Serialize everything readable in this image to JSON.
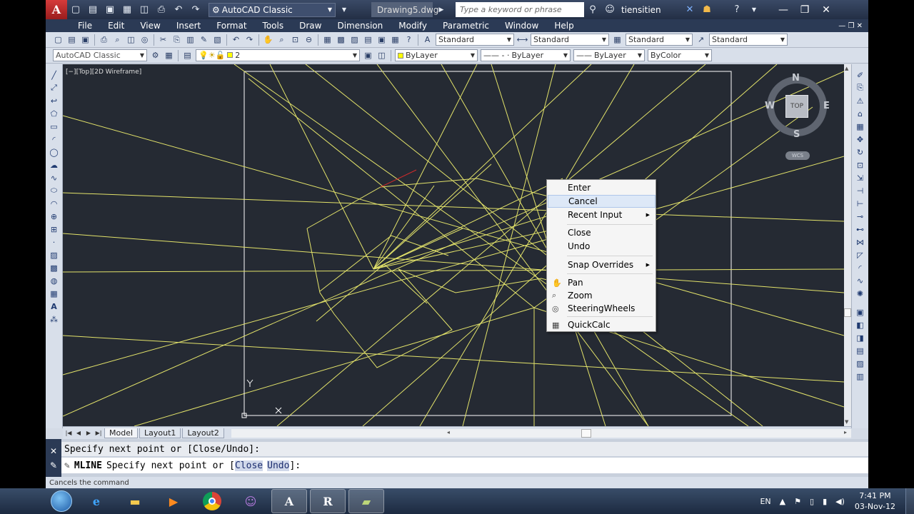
{
  "titlebar": {
    "logo_letter": "A",
    "workspace": "AutoCAD Classic",
    "file_name": "Drawing5.dwg",
    "search_placeholder": "Type a keyword or phrase",
    "user": "tiensitien"
  },
  "menu": [
    "File",
    "Edit",
    "View",
    "Insert",
    "Format",
    "Tools",
    "Draw",
    "Dimension",
    "Modify",
    "Parametric",
    "Window",
    "Help"
  ],
  "toolbar1": {
    "text_style": "Standard",
    "dim_style": "Standard",
    "table_style": "Standard",
    "mleader_style": "Standard"
  },
  "toolbar2": {
    "workspace": "AutoCAD Classic",
    "layer": "2",
    "color": "ByLayer",
    "linetype": "ByLayer",
    "lineweight": "ByLayer",
    "plotstyle": "ByColor"
  },
  "viewport": {
    "label": "[−][Top][2D Wireframe]"
  },
  "viewcube": {
    "north": "N",
    "south": "S",
    "east": "E",
    "west": "W",
    "face": "TOP",
    "ucs": "WCS"
  },
  "tabs": [
    "Model",
    "Layout1",
    "Layout2"
  ],
  "context_menu": {
    "items": [
      {
        "label": "Enter"
      },
      {
        "label": "Cancel"
      },
      {
        "label": "Recent Input"
      },
      {
        "label": "Close"
      },
      {
        "label": "Undo"
      },
      {
        "label": "Snap Overrides"
      },
      {
        "label": "Pan"
      },
      {
        "label": "Zoom"
      },
      {
        "label": "SteeringWheels"
      },
      {
        "label": "QuickCalc"
      }
    ]
  },
  "command": {
    "history": "Specify next point or [Close/Undo]:",
    "name": "MLINE",
    "prompt": "Specify next point or [",
    "opt1": "Close",
    "opt2": "Undo",
    "end": "]:"
  },
  "status_text": "Cancels the command",
  "taskbar": {
    "language": "EN",
    "time": "7:41 PM",
    "date": "03-Nov-12"
  },
  "colors": {
    "drawing_bg": "#252a33",
    "lines": "#e8e86a",
    "accent_red": "#d02b2b"
  }
}
